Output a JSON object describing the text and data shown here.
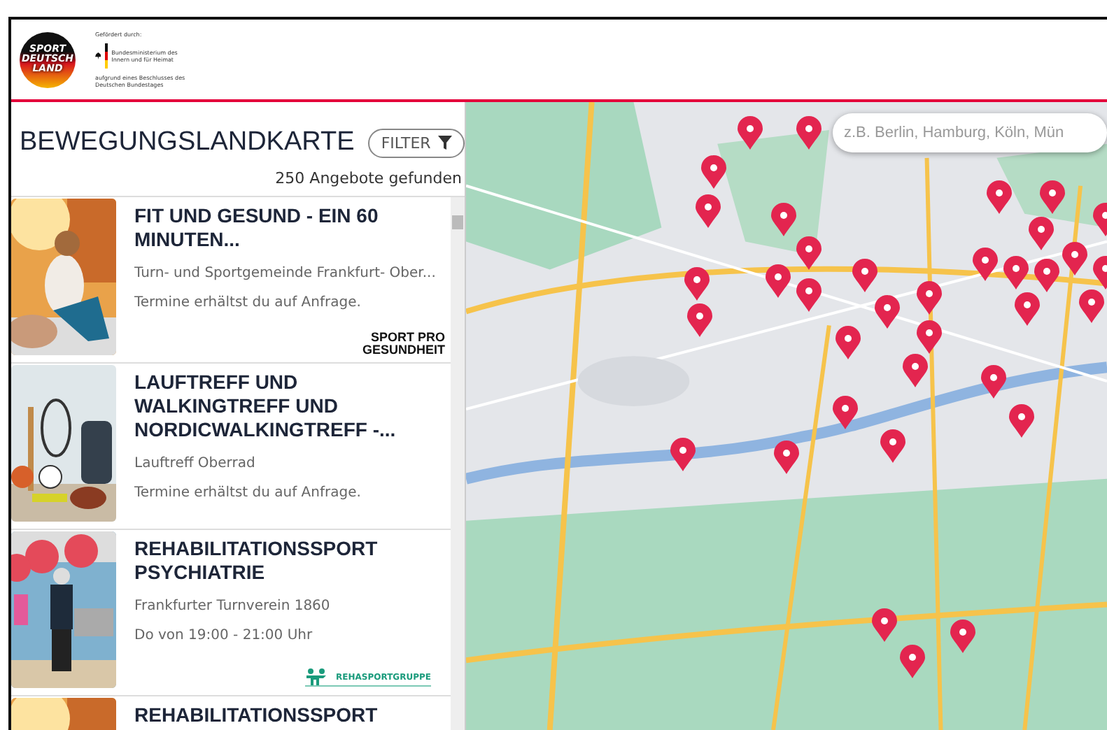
{
  "header": {
    "logo_lines": [
      "SPORT",
      "DEUTSCH",
      "LAND"
    ],
    "funding_note": "Gefördert durch:",
    "ministry": "Bundesministerium des Innern und für Heimat",
    "resolution": "aufgrund eines Beschlusses des Deutschen Bundestages"
  },
  "title": "BEWEGUNGSLANDKARTE",
  "filter_button": "FILTER",
  "result_count": "250 Angebote gefunden",
  "offers": [
    {
      "title": "FIT UND GESUND - EIN 60 MINUTEN...",
      "club": "Turn- und Sportgemeinde Frankfurt- Ober...",
      "schedule": "Termine erhältst du auf Anfrage.",
      "badge": {
        "kind": "sport-pro-gesundheit",
        "lines": [
          "SPORT PRO",
          "GESUNDHEIT"
        ]
      }
    },
    {
      "title": "LAUFTREFF UND WALKINGTREFF UND NORDICWALKINGTREFF -...",
      "club": "Lauftreff Oberrad",
      "schedule": "Termine erhältst du auf Anfrage."
    },
    {
      "title": "REHABILITATIONSSPORT PSYCHIATRIE",
      "club": "Frankfurter Turnverein 1860",
      "schedule": "Do von 19:00 - 21:00 Uhr",
      "badge": {
        "kind": "rehasport",
        "lines": [
          "REHASPORTGRUPPE"
        ]
      }
    },
    {
      "title": "REHABILITATIONSSPORT"
    }
  ],
  "map": {
    "search": {
      "placeholder": "z.B. Berlin, Hamburg, Köln, Mün"
    }
  }
}
